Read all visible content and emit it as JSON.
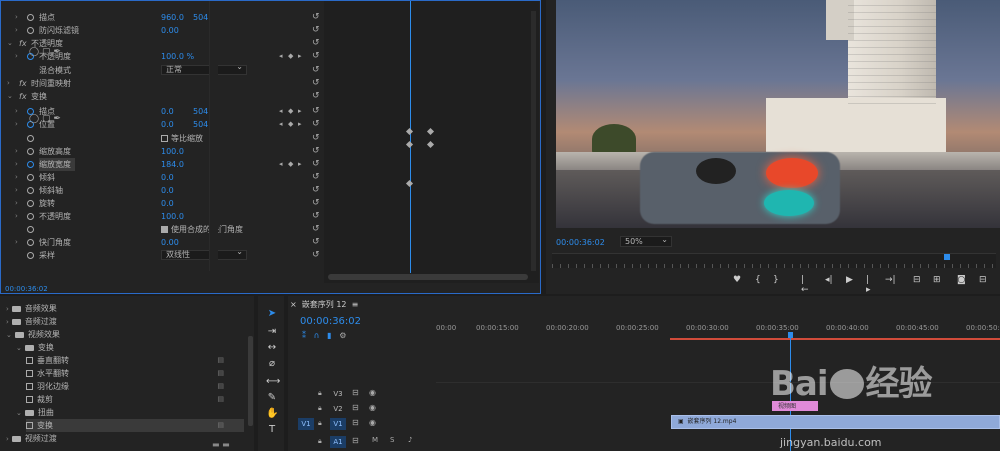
{
  "effects": {
    "rows": [
      {
        "label": "描点",
        "v1": "960.0",
        "v2": "504.0"
      },
      {
        "label": "防闪烁滤镜",
        "v1": "0.00"
      },
      {
        "label": "不透明度"
      },
      {
        "label": "不透明度",
        "v1": "100.0 %"
      },
      {
        "label": "混合模式",
        "select": "正常"
      },
      {
        "label": "时间重映射"
      },
      {
        "label": "变换"
      },
      {
        "label": "描点",
        "v1": "0.0",
        "v2": "504.0"
      },
      {
        "label": "位置",
        "v1": "0.0",
        "v2": "504.0"
      },
      {
        "label": "等比缩放"
      },
      {
        "label": "缩放高度",
        "v1": "100.0"
      },
      {
        "label": "缩放宽度",
        "v1": "184.0"
      },
      {
        "label": "倾斜",
        "v1": "0.0"
      },
      {
        "label": "倾斜轴",
        "v1": "0.0"
      },
      {
        "label": "旋转",
        "v1": "0.0"
      },
      {
        "label": "不透明度",
        "v1": "100.0"
      },
      {
        "label": "使用合成的快门角度"
      },
      {
        "label": "快门角度",
        "v1": "0.00"
      },
      {
        "label": "采样",
        "select": "双线性"
      }
    ],
    "timecode": "00:00:36:02"
  },
  "program": {
    "timecode": "00:00:36:02",
    "zoom": "50%"
  },
  "project": {
    "items": [
      {
        "label": "音频效果",
        "depth": 0
      },
      {
        "label": "音频过渡",
        "depth": 0
      },
      {
        "label": "视频效果",
        "depth": 0
      },
      {
        "label": "变换",
        "depth": 1
      },
      {
        "label": "垂直翻转",
        "depth": 2
      },
      {
        "label": "水平翻转",
        "depth": 2
      },
      {
        "label": "羽化边缘",
        "depth": 2
      },
      {
        "label": "裁剪",
        "depth": 2
      },
      {
        "label": "扭曲",
        "depth": 1
      },
      {
        "label": "变换",
        "depth": 2
      },
      {
        "label": "视频过渡",
        "depth": 0
      }
    ]
  },
  "timeline": {
    "tab": "嵌套序列 12",
    "timecode": "00:00:36:02",
    "ticks": [
      "00:00",
      "00:00:15:00",
      "00:00:20:00",
      "00:00:25:00",
      "00:00:30:00",
      "00:00:35:00",
      "00:00:40:00",
      "00:00:45:00",
      "00:00:50:00"
    ],
    "tracks": [
      "V3",
      "V2",
      "V1",
      "A1"
    ],
    "src_v": "V1",
    "src_a": "A1",
    "clip_label": "嵌套序列 12.mp4",
    "fx_clip_label": "视频图"
  },
  "watermark": {
    "brand": "Bai",
    "brand2": "经验",
    "url": "jingyan.baidu.com"
  },
  "colors": {
    "accent": "#2d8ceb",
    "clip": "#8fa9d9",
    "fxclip": "#e08ad8",
    "workbar": "#d04b3a"
  }
}
